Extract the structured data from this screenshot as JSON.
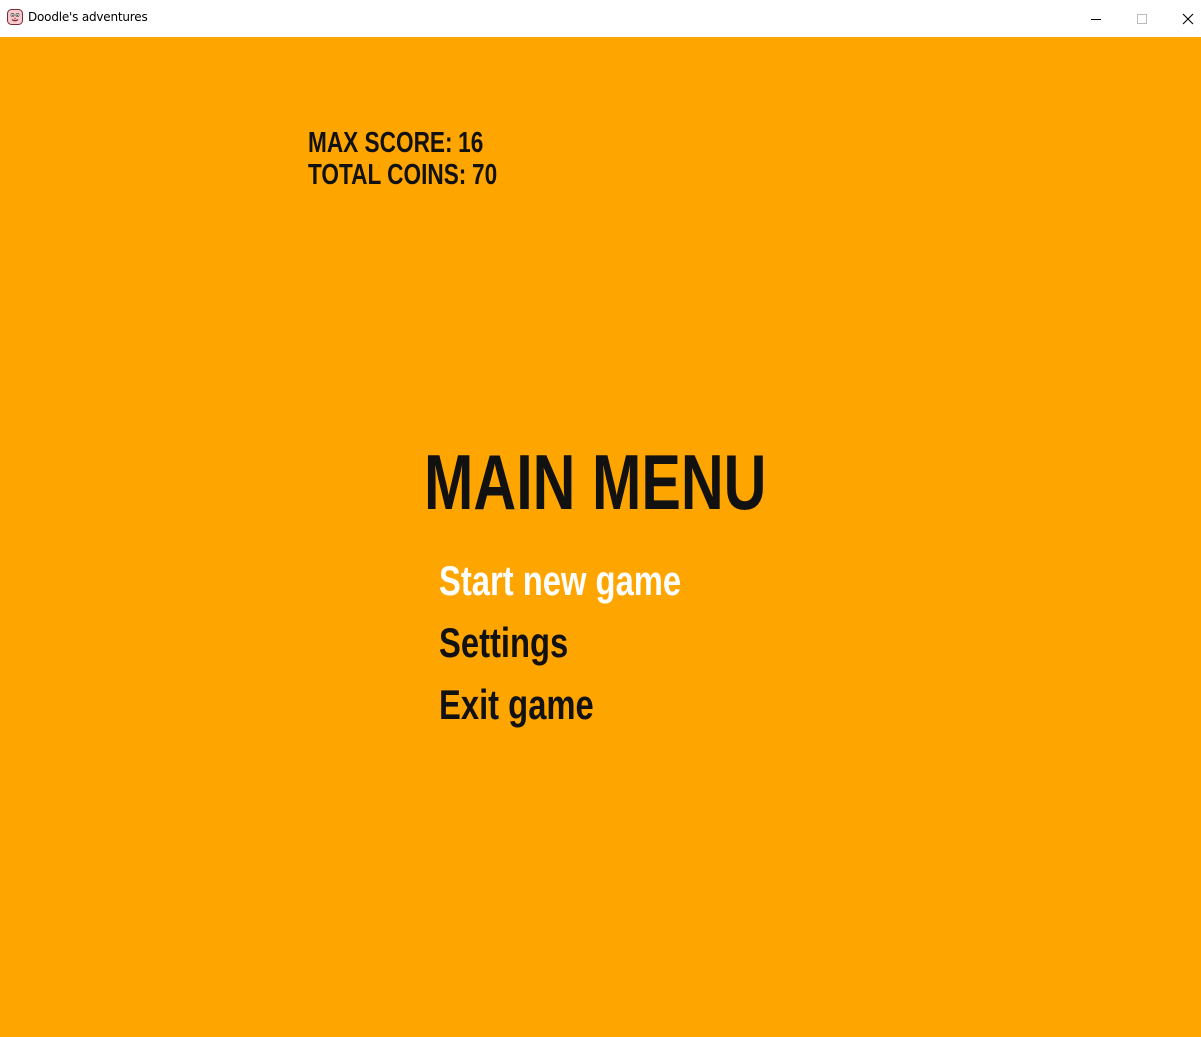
{
  "window": {
    "title": "Doodle's adventures",
    "icon": "doodle-face-icon",
    "controls": [
      "minimize-icon",
      "maximize-icon",
      "close-icon"
    ]
  },
  "stats": {
    "max_score_label": "MAX SCORE:",
    "max_score_value": "16",
    "total_coins_label": "TOTAL COINS:",
    "total_coins_value": "70"
  },
  "menu": {
    "title": "MAIN MENU",
    "items": [
      {
        "label": "Start new game",
        "selected": true
      },
      {
        "label": "Settings",
        "selected": false
      },
      {
        "label": "Exit game",
        "selected": false
      }
    ]
  },
  "colors": {
    "background": "#FFA500",
    "text": "#111111",
    "selected_text": "#FFFFFF"
  }
}
